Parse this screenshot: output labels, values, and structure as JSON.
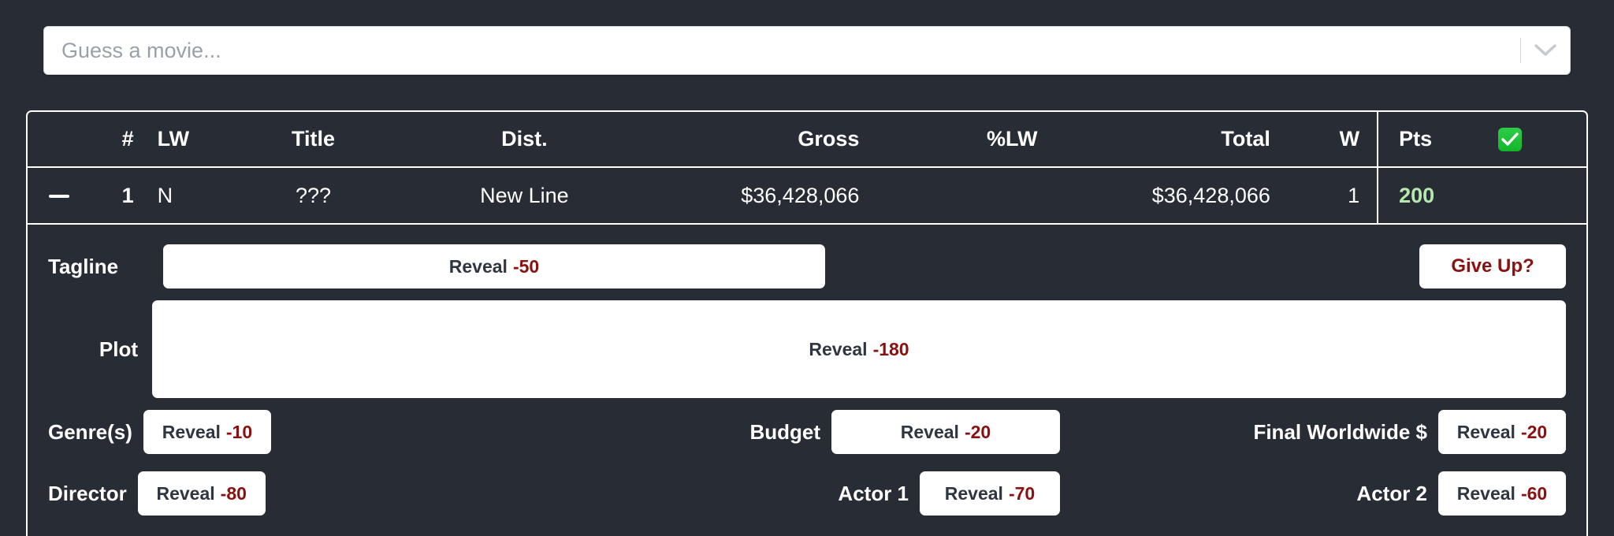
{
  "search": {
    "placeholder": "Guess a movie...",
    "value": "",
    "dropdown_icon": "chevron-down-icon"
  },
  "table": {
    "columns": [
      {
        "key": "toggle",
        "label": ""
      },
      {
        "key": "rank",
        "label": "#"
      },
      {
        "key": "lw",
        "label": "LW"
      },
      {
        "key": "title",
        "label": "Title"
      },
      {
        "key": "dist",
        "label": "Dist."
      },
      {
        "key": "gross",
        "label": "Gross"
      },
      {
        "key": "pctlw",
        "label": "%LW"
      },
      {
        "key": "total",
        "label": "Total"
      },
      {
        "key": "w",
        "label": "W"
      },
      {
        "key": "pts",
        "label": "Pts"
      },
      {
        "key": "check",
        "label": "check-mark-icon"
      }
    ],
    "rows": [
      {
        "toggle": "—",
        "rank": "1",
        "lw": "N",
        "title": "???",
        "dist": "New Line",
        "gross": "$36,428,066",
        "pctlw": "",
        "total": "$36,428,066",
        "w": "1",
        "pts": "200",
        "check": ""
      }
    ]
  },
  "reveals": {
    "tagline": {
      "label": "Tagline",
      "action": "Reveal",
      "cost": "-50"
    },
    "giveup": {
      "label": "Give Up?"
    },
    "plot": {
      "label": "Plot",
      "action": "Reveal",
      "cost": "-180"
    },
    "genres": {
      "label": "Genre(s)",
      "action": "Reveal",
      "cost": "-10"
    },
    "budget": {
      "label": "Budget",
      "action": "Reveal",
      "cost": "-20"
    },
    "final_worldwide": {
      "label": "Final Worldwide $",
      "action": "Reveal",
      "cost": "-20"
    },
    "director": {
      "label": "Director",
      "action": "Reveal",
      "cost": "-80"
    },
    "actor1": {
      "label": "Actor 1",
      "action": "Reveal",
      "cost": "-70"
    },
    "actor2": {
      "label": "Actor 2",
      "action": "Reveal",
      "cost": "-60"
    }
  },
  "colors": {
    "background": "#282c35",
    "panel_border": "#ffffff",
    "cost_red": "#8b1111",
    "points_green": "#b6e9ae",
    "check_green": "#1fc02f",
    "button_bg": "#ffffff",
    "button_text": "#2f3541"
  }
}
